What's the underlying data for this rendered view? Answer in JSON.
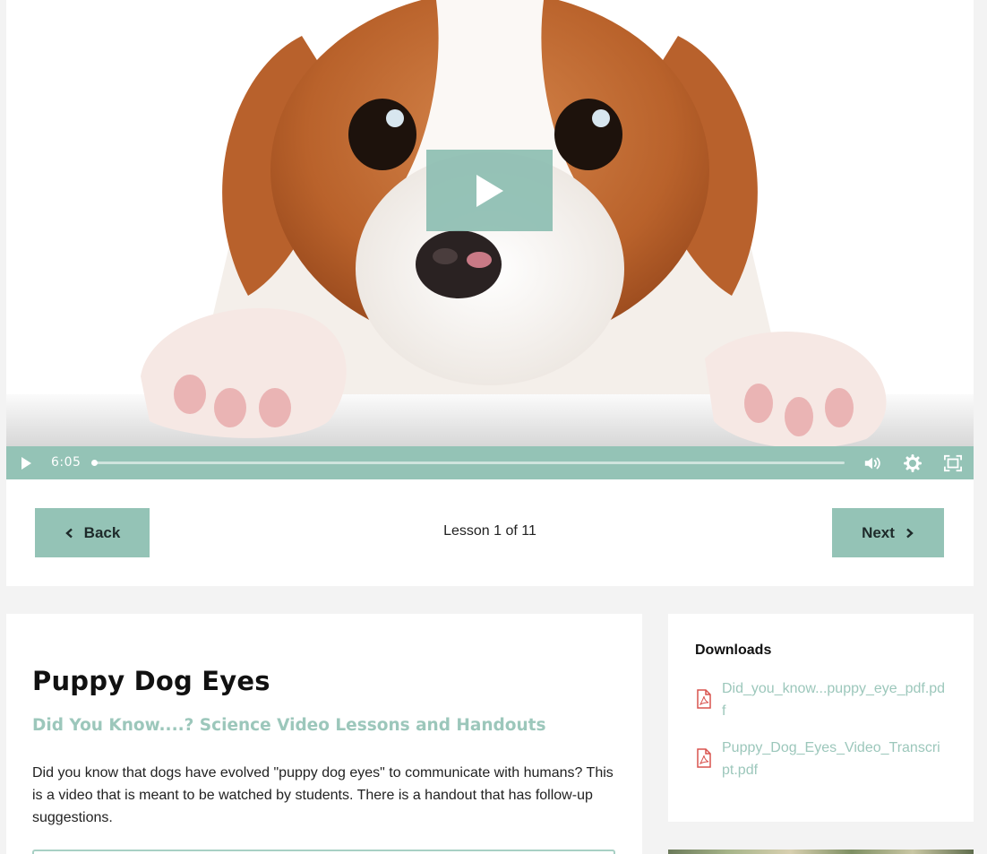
{
  "video": {
    "current_time": "6:05",
    "progress": 0.0
  },
  "navigation": {
    "back_label": "Back",
    "next_label": "Next",
    "lesson_counter": "Lesson 1 of 11"
  },
  "lesson": {
    "title": "Puppy Dog Eyes",
    "subtitle": "Did You Know....? Science Video Lessons and Handouts",
    "description": "Did you know that dogs have evolved \"puppy dog eyes\" to communicate with humans? This is a video that is meant to be watched by students. There is a handout that has follow-up suggestions."
  },
  "downloads": {
    "heading": "Downloads",
    "files": [
      {
        "name": "Did_you_know...puppy_eye_pdf.pdf",
        "icon": "pdf-file-icon"
      },
      {
        "name": "Puppy_Dog_Eyes_Video_Transcript.pdf",
        "icon": "pdf-file-icon"
      }
    ]
  },
  "colors": {
    "accent": "#94c3b6",
    "link": "#9cc7bb",
    "pdf_icon": "#d9534f"
  }
}
